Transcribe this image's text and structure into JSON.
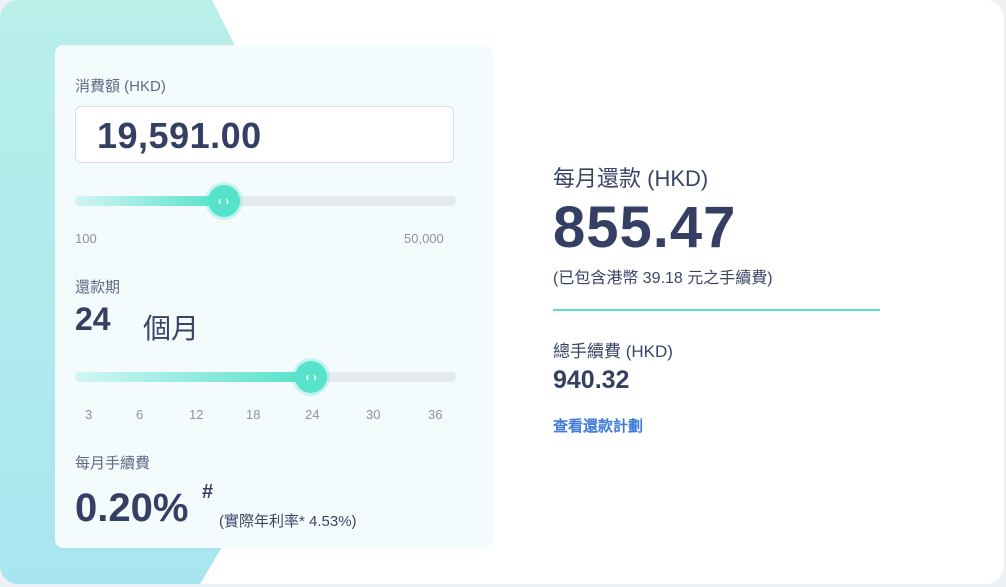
{
  "calculator": {
    "amount_label": "消費額 (HKD)",
    "amount_value": "19,591.00",
    "amount_fraction": 0.39,
    "amount_min": "100",
    "amount_max": "50,000",
    "term_label": "還款期",
    "term_value": "24",
    "term_unit": "個月",
    "term_fraction": 0.62,
    "term_ticks": [
      "3",
      "6",
      "12",
      "18",
      "24",
      "30",
      "36"
    ],
    "fee_label": "每月手續費",
    "fee_rate": "0.20%",
    "fee_mark": "#",
    "fee_apr_note": "(實際年利率* 4.53%)",
    "slider_thumb_glyph": "‹ ›"
  },
  "result": {
    "monthly_label": "每月還款 (HKD)",
    "monthly_value": "855.47",
    "monthly_note": "(已包含港幣 39.18 元之手續費)",
    "total_fee_label": "總手續費 (HKD)",
    "total_fee_value": "940.32",
    "plan_link": "查看還款計劃"
  },
  "colors": {
    "accent": "#56e3cb",
    "link": "#3f7bd9",
    "text_dark": "#353f63"
  }
}
